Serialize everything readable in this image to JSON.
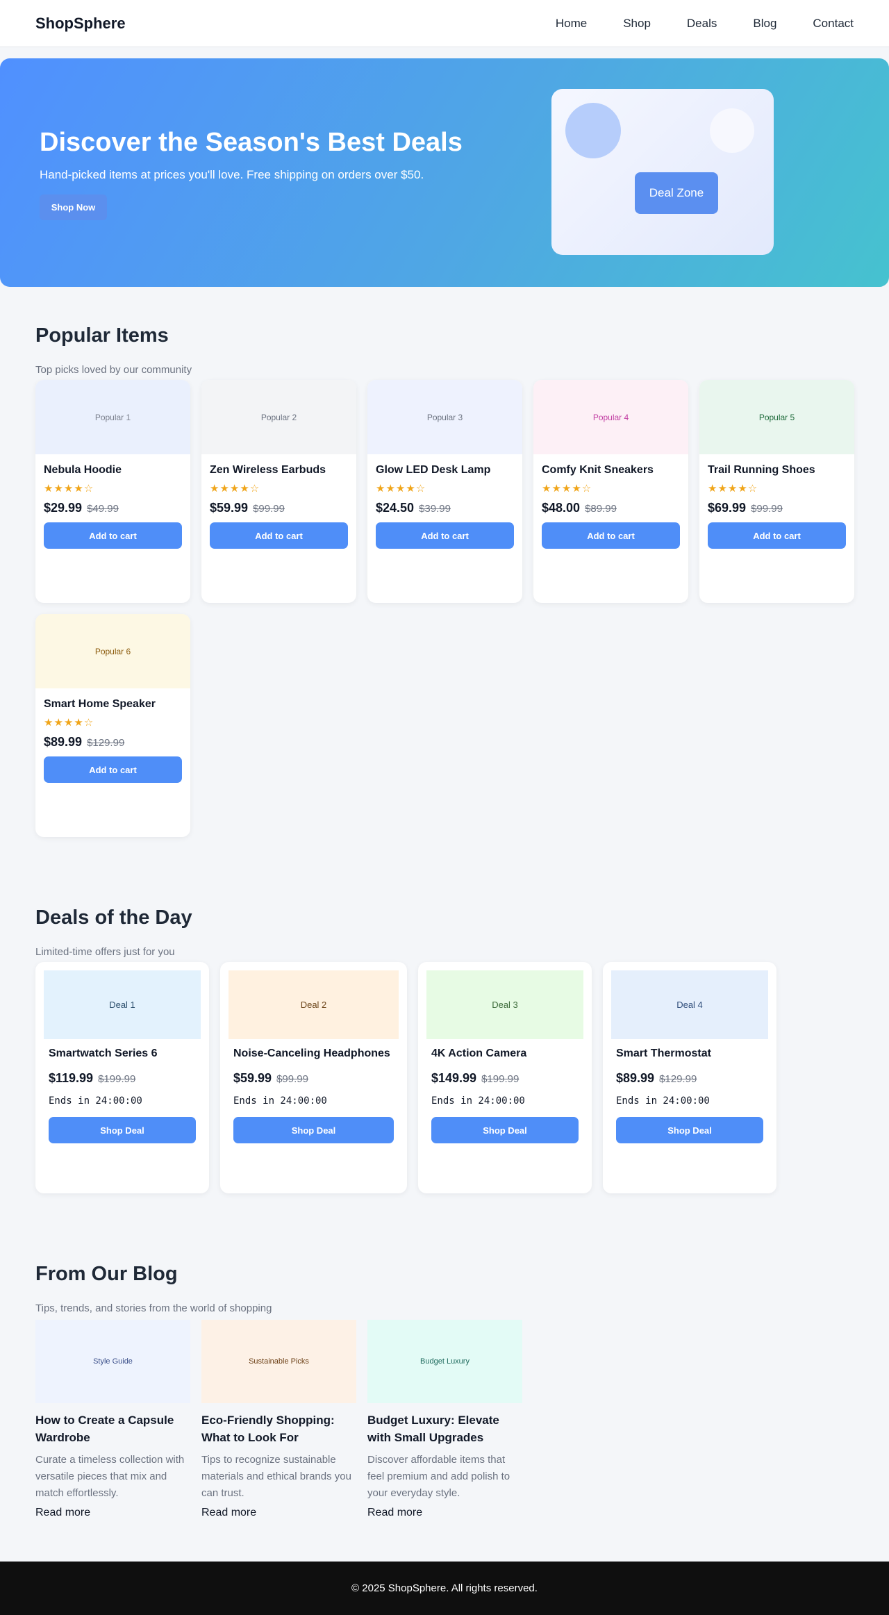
{
  "brand": "ShopSphere",
  "nav": [
    "Home",
    "Shop",
    "Deals",
    "Blog",
    "Contact"
  ],
  "hero": {
    "title": "Discover the Season's Best Deals",
    "subtitle": "Hand-picked items at prices you'll love. Free shipping on orders over $50.",
    "cta": "Shop Now",
    "card_label": "Deal Zone"
  },
  "popular": {
    "title": "Popular Items",
    "subtitle": "Top picks loved by our community",
    "add_label": "Add to cart",
    "items": [
      {
        "image_label": "Popular 1",
        "name": "Nebula Hoodie",
        "rating_stars": "★★★★☆",
        "rating": 4,
        "price": "$29.99",
        "old_price": "$49.99",
        "bg": "#eaf0fd",
        "fg": "#7a7f8c"
      },
      {
        "image_label": "Popular 2",
        "name": "Zen Wireless Earbuds",
        "rating_stars": "★★★★☆",
        "rating": 4,
        "price": "$59.99",
        "old_price": "$99.99",
        "bg": "#f3f4f6",
        "fg": "#6b7280"
      },
      {
        "image_label": "Popular 3",
        "name": "Glow LED Desk Lamp",
        "rating_stars": "★★★★☆",
        "rating": 4,
        "price": "$24.50",
        "old_price": "$39.99",
        "bg": "#eef2fe",
        "fg": "#6b7280"
      },
      {
        "image_label": "Popular 4",
        "name": "Comfy Knit Sneakers",
        "rating_stars": "★★★★☆",
        "rating": 4,
        "price": "$48.00",
        "old_price": "$89.99",
        "bg": "#fdf0f6",
        "fg": "#c23fa3"
      },
      {
        "image_label": "Popular 5",
        "name": "Trail Running Shoes",
        "rating_stars": "★★★★☆",
        "rating": 4,
        "price": "$69.99",
        "old_price": "$99.99",
        "bg": "#e9f6ee",
        "fg": "#1f6b3b"
      },
      {
        "image_label": "Popular 6",
        "name": "Smart Home Speaker",
        "rating_stars": "★★★★☆",
        "rating": 4,
        "price": "$89.99",
        "old_price": "$129.99",
        "bg": "#fdf8e4",
        "fg": "#8a5a0c"
      }
    ]
  },
  "deals": {
    "title": "Deals of the Day",
    "subtitle": "Limited-time offers just for you",
    "button_label": "Shop Deal",
    "items": [
      {
        "image_label": "Deal 1",
        "name": "Smartwatch Series 6",
        "price": "$119.99",
        "old_price": "$199.99",
        "ends": "Ends in 24:00:00",
        "bg": "#e3f2fd",
        "fg": "#2a4d6b"
      },
      {
        "image_label": "Deal 2",
        "name": "Noise-Canceling Headphones",
        "price": "$59.99",
        "old_price": "$99.99",
        "ends": "Ends in 24:00:00",
        "bg": "#fff1e0",
        "fg": "#6b4418"
      },
      {
        "image_label": "Deal 3",
        "name": "4K Action Camera",
        "price": "$149.99",
        "old_price": "$199.99",
        "ends": "Ends in 24:00:00",
        "bg": "#e7fbe4",
        "fg": "#3d6b3a"
      },
      {
        "image_label": "Deal 4",
        "name": "Smart Thermostat",
        "price": "$89.99",
        "old_price": "$129.99",
        "ends": "Ends in 24:00:00",
        "bg": "#e5effc",
        "fg": "#2f4d7a"
      }
    ]
  },
  "blog": {
    "title": "From Our Blog",
    "subtitle": "Tips, trends, and stories from the world of shopping",
    "read_more": "Read more",
    "posts": [
      {
        "image_label": "Style Guide",
        "title": "How to Create a Capsule Wardrobe",
        "excerpt": "Curate a timeless collection with versatile pieces that mix and match effortlessly.",
        "bg": "#eef3fe",
        "fg": "#3b4f8a"
      },
      {
        "image_label": "Sustainable Picks",
        "title": "Eco-Friendly Shopping: What to Look For",
        "excerpt": "Tips to recognize sustainable materials and ethical brands you can trust.",
        "bg": "#fdf1e6",
        "fg": "#6b3f15"
      },
      {
        "image_label": "Budget Luxury",
        "title": "Budget Luxury: Elevate with Small Upgrades",
        "excerpt": "Discover affordable items that feel premium and add polish to your everyday style.",
        "bg": "#e3fbf6",
        "fg": "#1f6b5e"
      }
    ]
  },
  "footer": "© 2025 ShopSphere. All rights reserved."
}
